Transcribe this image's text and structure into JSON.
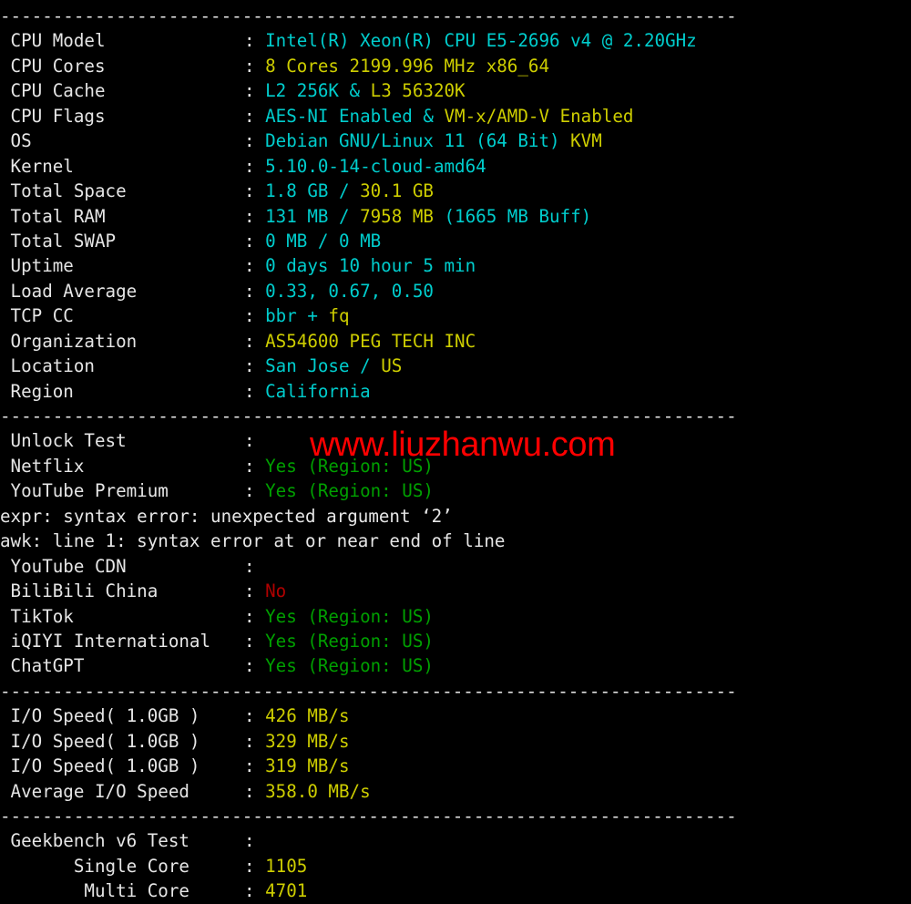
{
  "terminal": {
    "separator": "----------------------------------------------------------------------",
    "colors": {
      "background": "#000000",
      "foreground": "#e6e6e6",
      "cyan": "#00cdcd",
      "yellow": "#cdcd00",
      "green": "#00a000",
      "red": "#b00000",
      "watermark_red": "#ff0000"
    }
  },
  "watermark": {
    "text": "www.liuzhanwu.com"
  },
  "sections": {
    "system_info": {
      "rows": [
        {
          "label": " CPU Model",
          "parts": [
            {
              "text": "Intel(R) Xeon(R) CPU E5-2696 v4 @ 2.20GHz",
              "color": "cyan"
            }
          ]
        },
        {
          "label": " CPU Cores",
          "parts": [
            {
              "text": "8 Cores 2199.996 MHz x86_64",
              "color": "yellow"
            }
          ]
        },
        {
          "label": " CPU Cache",
          "parts": [
            {
              "text": "L2 256K & ",
              "color": "cyan"
            },
            {
              "text": "L3 56320K",
              "color": "yellow"
            }
          ]
        },
        {
          "label": " CPU Flags",
          "parts": [
            {
              "text": "AES-NI Enabled & ",
              "color": "cyan"
            },
            {
              "text": "VM-x/AMD-V Enabled",
              "color": "yellow"
            }
          ]
        },
        {
          "label": " OS",
          "parts": [
            {
              "text": "Debian GNU/Linux 11 (64 Bit) ",
              "color": "cyan"
            },
            {
              "text": "KVM",
              "color": "yellow"
            }
          ]
        },
        {
          "label": " Kernel",
          "parts": [
            {
              "text": "5.10.0-14-cloud-amd64",
              "color": "cyan"
            }
          ]
        },
        {
          "label": " Total Space",
          "parts": [
            {
              "text": "1.8 GB / ",
              "color": "cyan"
            },
            {
              "text": "30.1 GB",
              "color": "yellow"
            }
          ]
        },
        {
          "label": " Total RAM",
          "parts": [
            {
              "text": "131 MB / ",
              "color": "cyan"
            },
            {
              "text": "7958 MB ",
              "color": "yellow"
            },
            {
              "text": "(1665 MB Buff)",
              "color": "cyan"
            }
          ]
        },
        {
          "label": " Total SWAP",
          "parts": [
            {
              "text": "0 MB / 0 MB",
              "color": "cyan"
            }
          ]
        },
        {
          "label": " Uptime",
          "parts": [
            {
              "text": "0 days 10 hour 5 min",
              "color": "cyan"
            }
          ]
        },
        {
          "label": " Load Average",
          "parts": [
            {
              "text": "0.33, 0.67, 0.50",
              "color": "cyan"
            }
          ]
        },
        {
          "label": " TCP CC",
          "parts": [
            {
              "text": "bbr + ",
              "color": "cyan"
            },
            {
              "text": "fq",
              "color": "yellow"
            }
          ]
        },
        {
          "label": " Organization",
          "parts": [
            {
              "text": "AS54600 PEG TECH INC",
              "color": "yellow"
            }
          ]
        },
        {
          "label": " Location",
          "parts": [
            {
              "text": "San Jose / ",
              "color": "cyan"
            },
            {
              "text": "US",
              "color": "yellow"
            }
          ]
        },
        {
          "label": " Region",
          "parts": [
            {
              "text": "California",
              "color": "cyan"
            }
          ]
        }
      ]
    },
    "unlock_test": {
      "rows": [
        {
          "label": " Unlock Test",
          "parts": []
        },
        {
          "label": " Netflix",
          "parts": [
            {
              "text": "Yes (Region: US)",
              "color": "green"
            }
          ]
        },
        {
          "label": " YouTube Premium",
          "parts": [
            {
              "text": "Yes (Region: US)",
              "color": "green"
            }
          ]
        }
      ],
      "errors": [
        "expr: syntax error: unexpected argument ‘2’",
        "awk: line 1: syntax error at or near end of line"
      ],
      "rows2": [
        {
          "label": " YouTube CDN",
          "parts": []
        },
        {
          "label": " BiliBili China",
          "parts": [
            {
              "text": "No",
              "color": "red"
            }
          ]
        },
        {
          "label": " TikTok",
          "parts": [
            {
              "text": "Yes (Region: US)",
              "color": "green"
            }
          ]
        },
        {
          "label": " iQIYI International",
          "parts": [
            {
              "text": "Yes (Region: US)",
              "color": "green"
            }
          ]
        },
        {
          "label": " ChatGPT",
          "parts": [
            {
              "text": "Yes (Region: US)",
              "color": "green"
            }
          ]
        }
      ]
    },
    "io_speed": {
      "rows": [
        {
          "label": " I/O Speed( 1.0GB )",
          "parts": [
            {
              "text": "426 MB/s",
              "color": "yellow"
            }
          ]
        },
        {
          "label": " I/O Speed( 1.0GB )",
          "parts": [
            {
              "text": "329 MB/s",
              "color": "yellow"
            }
          ]
        },
        {
          "label": " I/O Speed( 1.0GB )",
          "parts": [
            {
              "text": "319 MB/s",
              "color": "yellow"
            }
          ]
        },
        {
          "label": " Average I/O Speed",
          "parts": [
            {
              "text": "358.0 MB/s",
              "color": "yellow"
            }
          ]
        }
      ]
    },
    "geekbench": {
      "rows": [
        {
          "label": " Geekbench v6 Test",
          "parts": []
        },
        {
          "label": "       Single Core",
          "parts": [
            {
              "text": "1105",
              "color": "yellow"
            }
          ]
        },
        {
          "label": "        Multi Core",
          "parts": [
            {
              "text": "4701",
              "color": "yellow"
            }
          ]
        }
      ]
    }
  }
}
